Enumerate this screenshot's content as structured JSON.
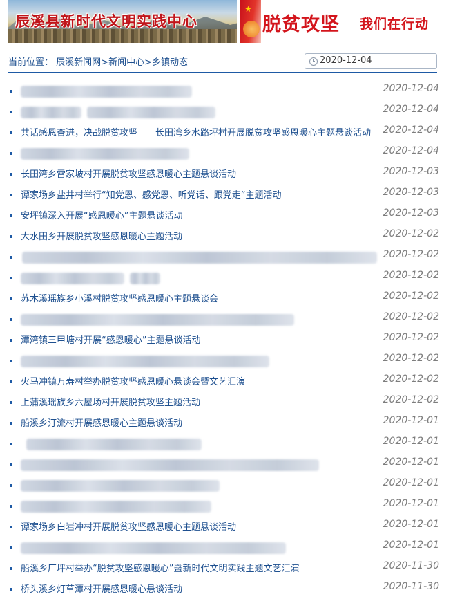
{
  "header": {
    "banner_left_title": "辰溪县新时代文明实践中心",
    "banner_right_main": "脱贫攻坚",
    "banner_right_sub": "我们在行动"
  },
  "breadcrumb": {
    "label": "当前位置：",
    "items": [
      "辰溪新闻网",
      "新闻中心",
      "乡镇动态"
    ],
    "separator": ">"
  },
  "date_filter": {
    "value": "2020-12-04",
    "icon": "clock-icon"
  },
  "news": [
    {
      "title": "",
      "date": "2020-12-04"
    },
    {
      "title": "",
      "date": "2020-12-04"
    },
    {
      "title": "共话感恩奋进，决战脱贫攻坚——长田湾乡水路坪村开展脱贫攻坚感恩暖心主题悬谈活动",
      "date": "2020-12-04"
    },
    {
      "title": "",
      "date": "2020-12-04"
    },
    {
      "title": "长田湾乡雷家坡村开展脱贫攻坚感恩暖心主题悬谈活动",
      "date": "2020-12-03"
    },
    {
      "title": "谭家场乡盐井村举行“知党恩、感党恩、听党话、跟党走”主题活动",
      "date": "2020-12-03"
    },
    {
      "title": "安坪镇深入开展“感恩暖心”主题悬谈活动",
      "date": "2020-12-03"
    },
    {
      "title": "大水田乡开展脱贫攻坚感恩暖心主题活动",
      "date": "2020-12-02"
    },
    {
      "title": "",
      "date": "2020-12-02"
    },
    {
      "title": "",
      "date": "2020-12-02"
    },
    {
      "title": "苏木溪瑶族乡小溪村脱贫攻坚感恩暖心主题悬谈会",
      "date": "2020-12-02"
    },
    {
      "title": "",
      "date": "2020-12-02"
    },
    {
      "title": "潭湾镇三甲塘村开展“感恩暖心”主题悬谈活动",
      "date": "2020-12-02"
    },
    {
      "title": "",
      "date": "2020-12-02"
    },
    {
      "title": "火马冲镇万寿村举办脱贫攻坚感恩暖心悬谈会暨文艺汇演",
      "date": "2020-12-02"
    },
    {
      "title": "上蒲溪瑶族乡六屋场村开展脱贫攻坚主题活动",
      "date": "2020-12-02"
    },
    {
      "title": "船溪乡汀流村开展感恩暖心主题悬谈活动",
      "date": "2020-12-01"
    },
    {
      "title": "",
      "date": "2020-12-01"
    },
    {
      "title": "",
      "date": "2020-12-01"
    },
    {
      "title": "",
      "date": "2020-12-01"
    },
    {
      "title": "",
      "date": "2020-12-01"
    },
    {
      "title": "谭家场乡白岩冲村开展脱贫攻坚感恩暖心主题悬谈活动",
      "date": "2020-12-01"
    },
    {
      "title": "",
      "date": "2020-12-01"
    },
    {
      "title": "船溪乡厂坪村举办“脱贫攻坚感恩暖心”暨新时代文明实践主题文艺汇演",
      "date": "2020-11-30"
    },
    {
      "title": "桥头溪乡灯草潭村开展感恩暖心悬谈活动",
      "date": "2020-11-30"
    }
  ],
  "colors": {
    "link": "#1d4f8f",
    "accent_line": "#1e5aa5",
    "date_text": "#7d7d7d",
    "banner_red": "#d3151c"
  }
}
